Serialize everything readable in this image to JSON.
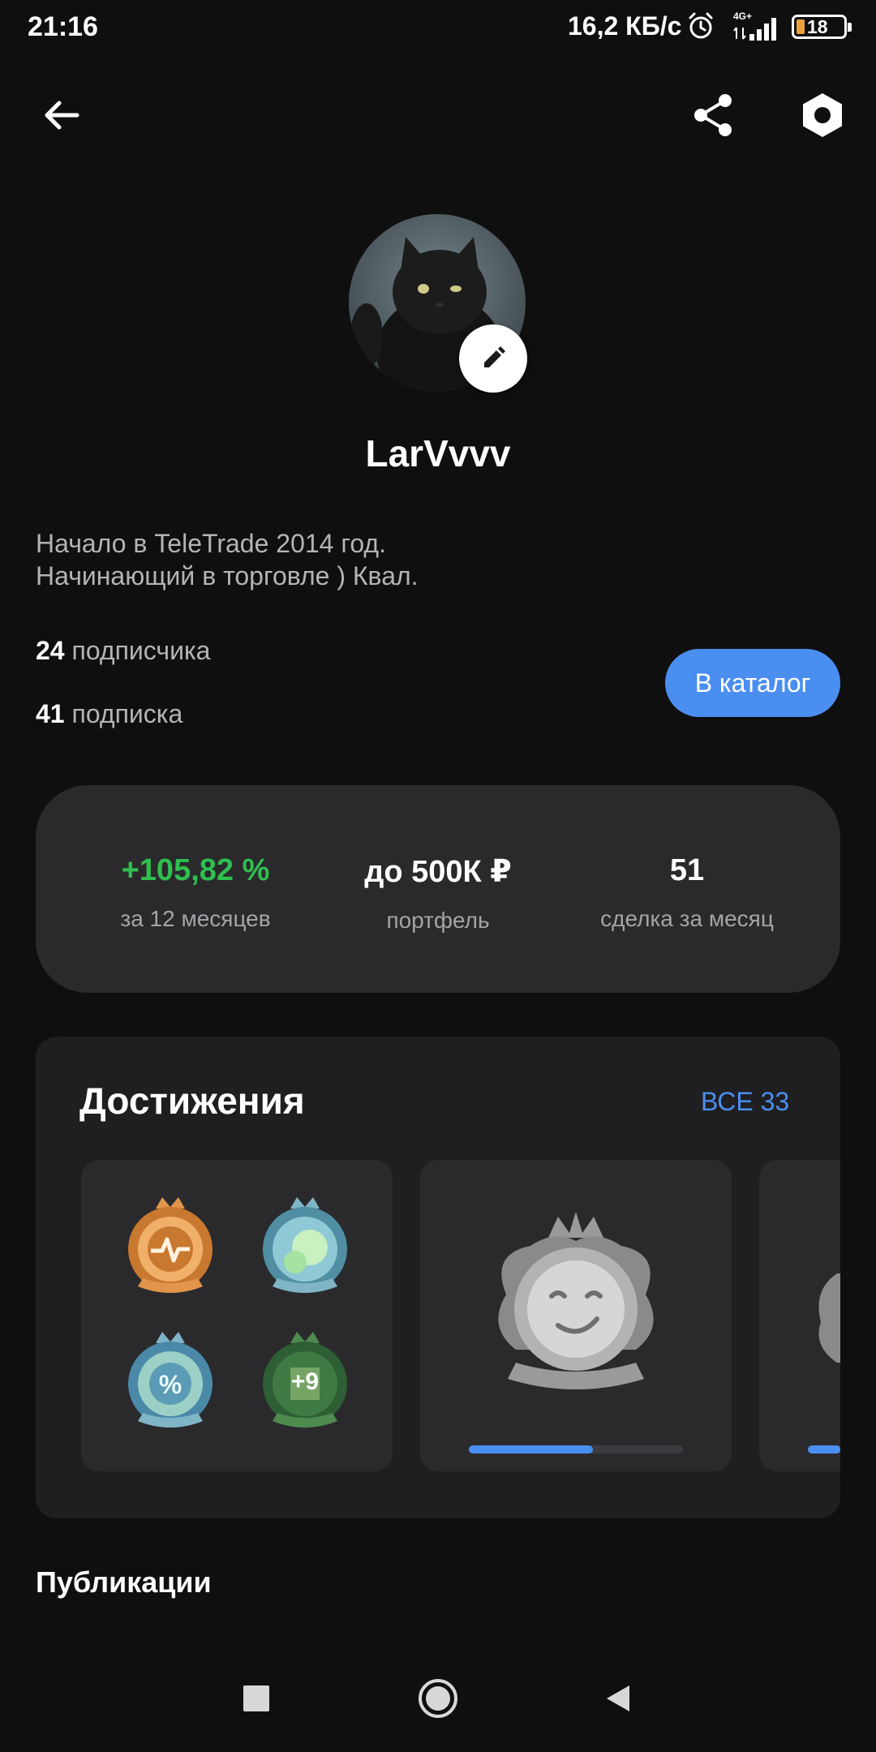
{
  "status_bar": {
    "time": "21:16",
    "net_speed": "16,2 КБ/с",
    "network": "4G+",
    "battery": "18"
  },
  "top_bar": {
    "back_icon": "arrow-left-icon",
    "share_icon": "share-icon",
    "settings_icon": "settings-hexagon-icon"
  },
  "profile": {
    "username": "LarVvvv",
    "bio": [
      "Начало в TeleTrade 2014 год.",
      "Начинающий в торговле ) Квал."
    ],
    "followers_count": "24",
    "followers_label": "подписчика",
    "following_count": "41",
    "following_label": "подписка",
    "catalog_button": "В каталог"
  },
  "stats": [
    {
      "value": "+105,82 %",
      "label": "за 12 месяцев",
      "color": "#2fbf4f"
    },
    {
      "value": "до 500К ₽",
      "label": "портфель",
      "color": "#ffffff"
    },
    {
      "value": "51",
      "label": "сделка за месяц",
      "color": "#ffffff"
    }
  ],
  "achievements": {
    "title": "Достижения",
    "all_link": "ВСЕ 33",
    "group_badges": [
      "pulse-badge-icon",
      "coins-badge-icon",
      "percent-badge-icon",
      "money-badge-icon"
    ],
    "more_count": "+9",
    "featured_badge": "smile-badge-icon",
    "featured_progress": 0.58,
    "accent_color": "#4a8ef0"
  },
  "publications_title": "Публикации",
  "nav_bar": {
    "items": [
      "recents-square-icon",
      "home-circle-icon",
      "back-triangle-icon"
    ]
  }
}
